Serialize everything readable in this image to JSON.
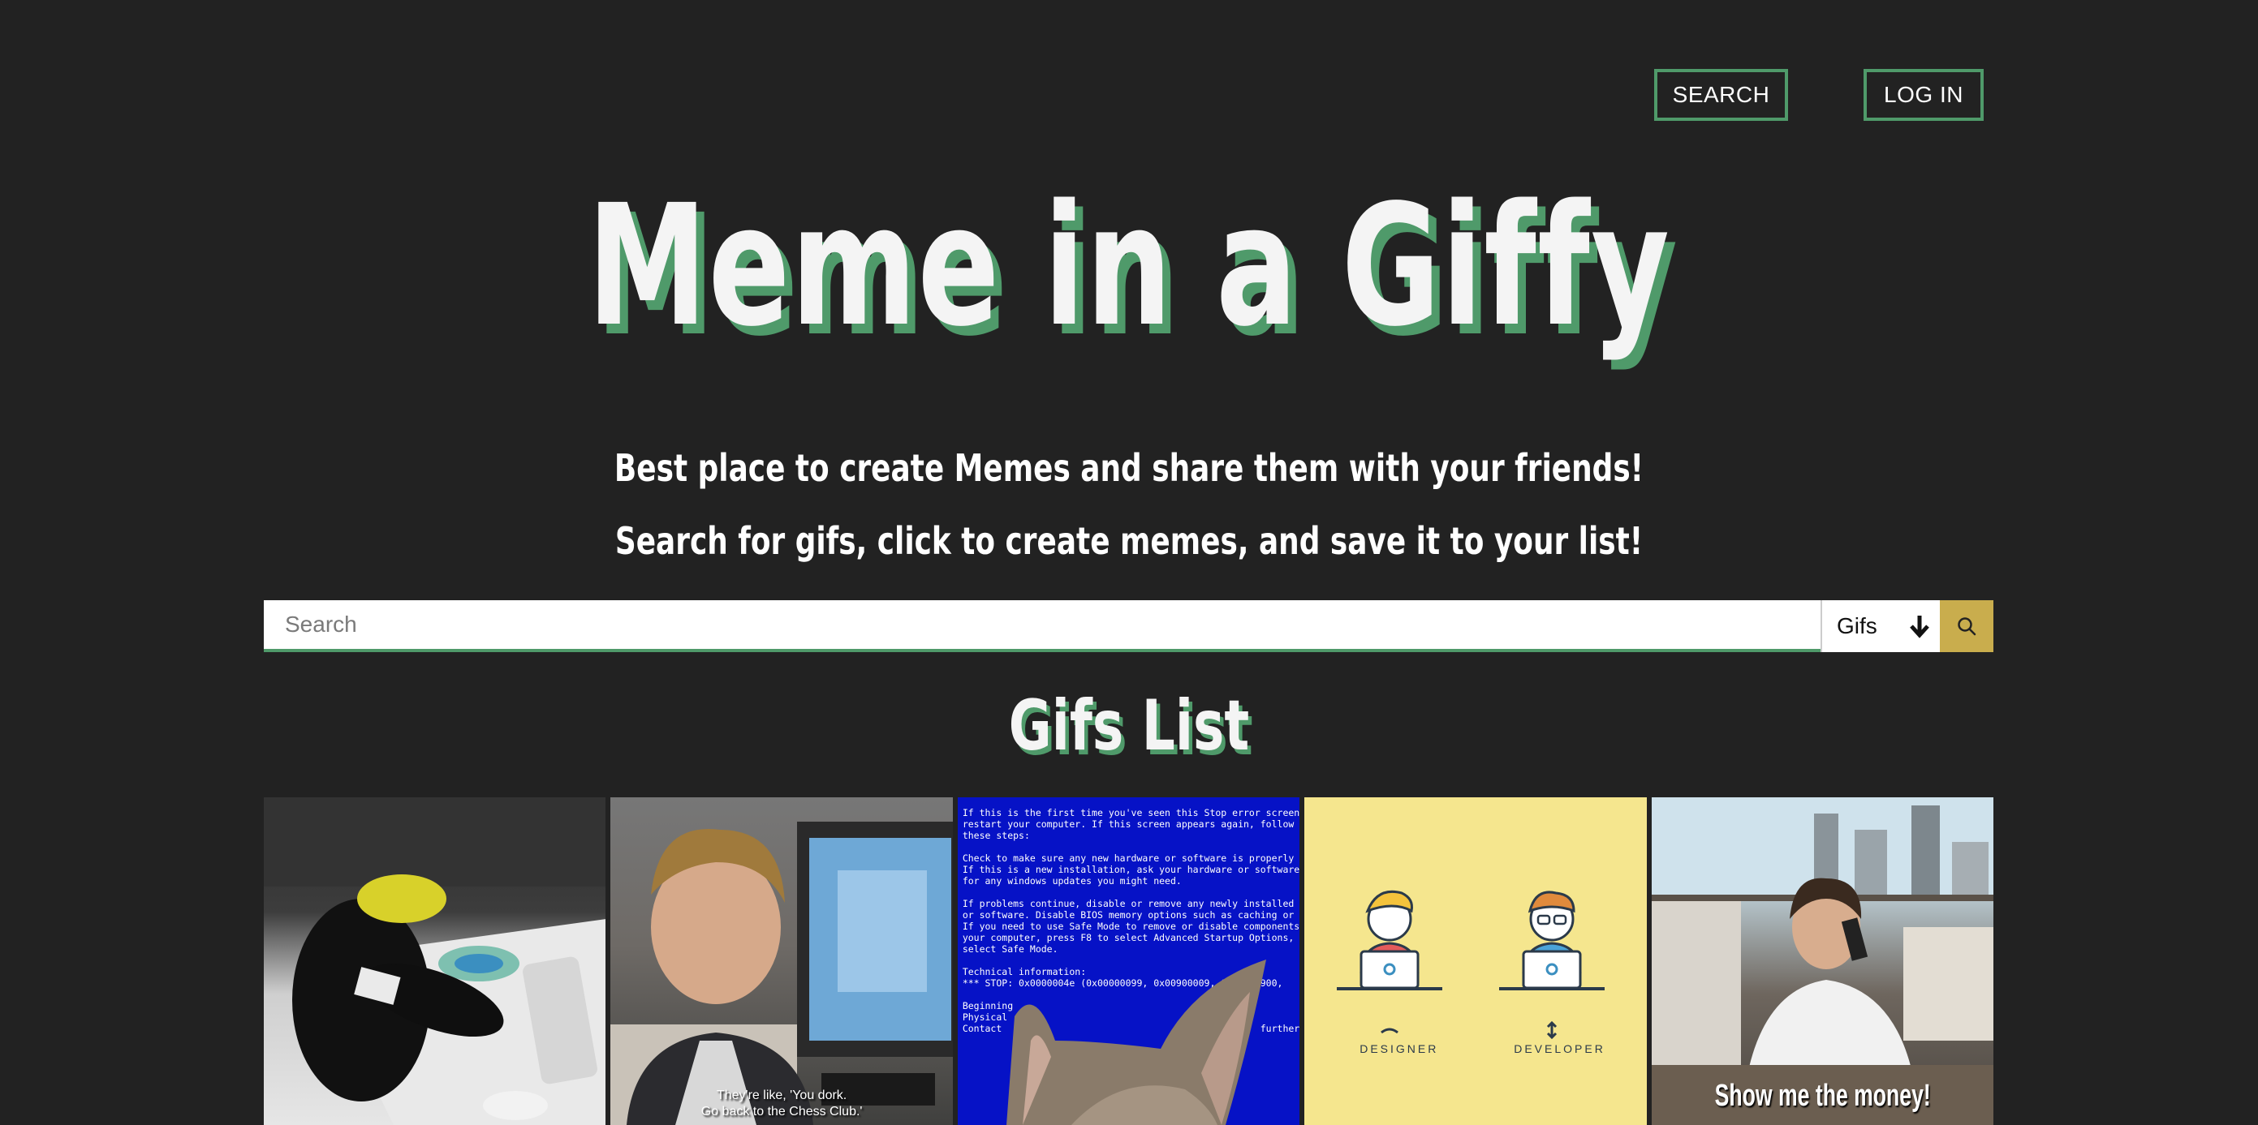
{
  "nav": {
    "search_label": "SEARCH",
    "login_label": "LOG IN"
  },
  "hero": {
    "title": "Meme in a Giffy",
    "subtitle_1": "Best place to create Memes and share them with your friends!",
    "subtitle_2": "Search for gifs, click to create memes, and save it to your list!"
  },
  "search": {
    "placeholder": "Search",
    "value": "",
    "type_selected": "Gifs",
    "type_icon": "arrow-down-icon",
    "button_icon": "search-icon"
  },
  "list": {
    "title": "Gifs List",
    "items": [
      {
        "caption": ""
      },
      {
        "caption_line1": "They're like, 'You dork.",
        "caption_line2": "Go back to the Chess Club.'"
      },
      {
        "screen_text": "If this is the first time you've seen this Stop error screen,\nrestart your computer. If this screen appears again, follow\nthese steps:\n\nCheck to make sure any new hardware or software is properly installed.\nIf this is a new installation, ask your hardware or software manufacturer\nfor any windows updates you might need.\n\nIf problems continue, disable or remove any newly installed hardware\nor software. Disable BIOS memory options such as caching or shadowing.\nIf you need to use Safe Mode to remove or disable components, restart\nyour computer, press F8 to select Advanced Startup Options, and then\nselect Safe Mode.\n\nTechnical information:\n*** STOP: 0x0000004e (0x00000099, 0x00900009, 0x00000900,\n\nBeginning\nPhysical\nContact                                              further"
      },
      {
        "label_left": "DESIGNER",
        "label_right": "DEVELOPER"
      },
      {
        "caption": "Show me the money!"
      }
    ]
  },
  "colors": {
    "background": "#222222",
    "accent_green": "#4f9a6a",
    "search_button": "#c9ad4d"
  }
}
